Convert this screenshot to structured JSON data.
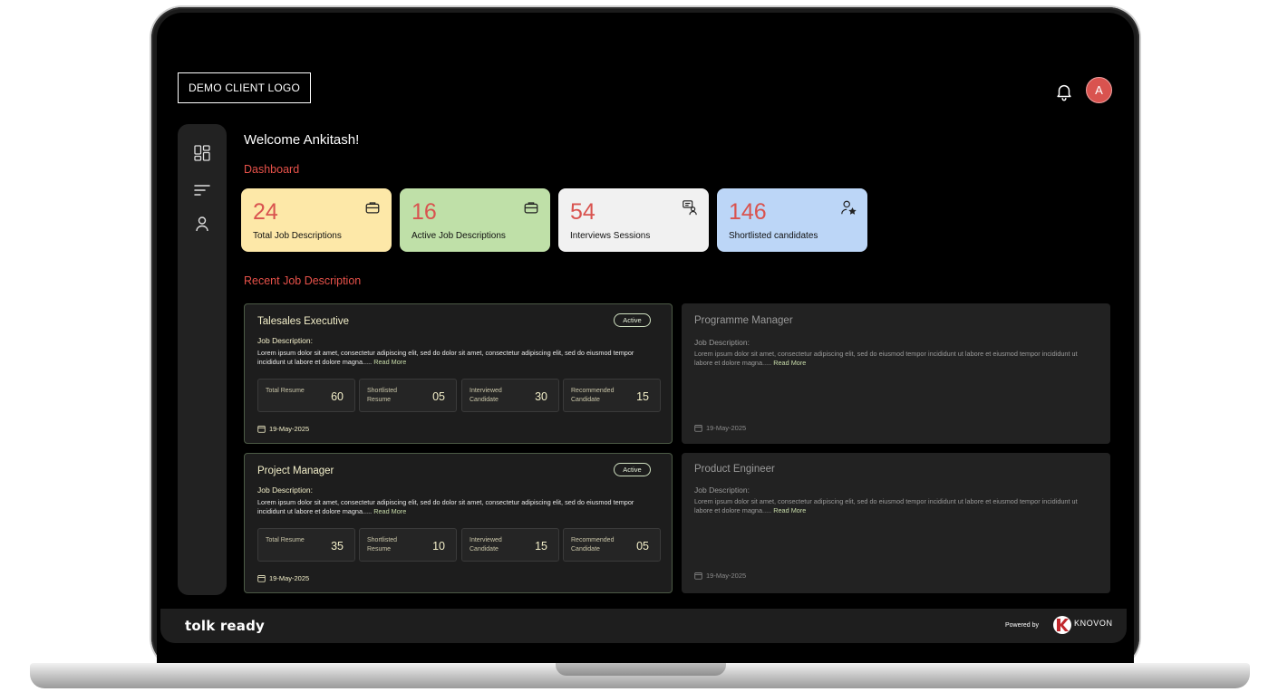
{
  "header": {
    "logo_text": "DEMO CLIENT LOGO",
    "avatar_initial": "A"
  },
  "main": {
    "welcome": "Welcome Ankitash!",
    "dashboard_label": "Dashboard",
    "recent_label": "Recent Job Description"
  },
  "stats": [
    {
      "value": "24",
      "label": "Total Job Descriptions",
      "icon": "briefcase-icon",
      "bg": "#fde8a8"
    },
    {
      "value": "16",
      "label": "Active Job Descriptions",
      "icon": "briefcase-icon",
      "bg": "#bfe0a8"
    },
    {
      "value": "54",
      "label": "Interviews Sessions",
      "icon": "interview-icon",
      "bg": "#f1f1f1"
    },
    {
      "value": "146",
      "label": "Shortlisted candidates",
      "icon": "user-star-icon",
      "bg": "#bcd6f7"
    }
  ],
  "jobs": [
    {
      "title": "Talesales Executive",
      "status": "Active",
      "jd_heading": "Job Description:",
      "jd_text": "Lorem ipsum dolor sit amet, consectetur adipiscing elit, sed do dolor sit amet, consectetur adipiscing elit, sed do eiusmod tempor incididunt ut labore et dolore magna.....",
      "read_more": "Read More",
      "stats": [
        {
          "label": "Total Resume",
          "value": "60"
        },
        {
          "label": "Shortlisted Resume",
          "value": "05"
        },
        {
          "label": "Interviewed Candidate",
          "value": "30"
        },
        {
          "label": "Recommended Candidate",
          "value": "15"
        }
      ],
      "date": "19-May-2025"
    },
    {
      "title": "Programme Manager",
      "jd_heading": "Job Description:",
      "jd_text": "Lorem ipsum dolor sit amet, consectetur adipiscing elit, sed do eiusmod tempor incididunt ut labore et  eiusmod tempor incididunt ut labore et dolore magna.....",
      "read_more": "Read More",
      "date": "19-May-2025"
    },
    {
      "title": "Project Manager",
      "status": "Active",
      "jd_heading": "Job Description:",
      "jd_text": "Lorem ipsum dolor sit amet, consectetur adipiscing elit, sed do dolor sit amet, consectetur adipiscing elit, sed do eiusmod tempor incididunt ut labore et dolore magna.....",
      "read_more": "Read More",
      "stats": [
        {
          "label": "Total Resume",
          "value": "35"
        },
        {
          "label": "Shortlisted Resume",
          "value": "10"
        },
        {
          "label": "Interviewed Candidate",
          "value": "15"
        },
        {
          "label": "Recommended Candidate",
          "value": "05"
        }
      ],
      "date": "19-May-2025"
    },
    {
      "title": "Product Engineer",
      "jd_heading": "Job Description:",
      "jd_text": "Lorem ipsum dolor sit amet, consectetur adipiscing elit, sed do eiusmod tempor incididunt ut labore et  eiusmod tempor incididunt ut labore et dolore magna.....",
      "read_more": "Read More",
      "date": "19-May-2025"
    }
  ],
  "footer": {
    "brand": "tolk ready",
    "powered_by": "Powered by",
    "company": "KNOVON"
  },
  "colors": {
    "accent": "#e8524a",
    "active_text": "#f3efc9",
    "card_bg": "#1d1d1d"
  }
}
